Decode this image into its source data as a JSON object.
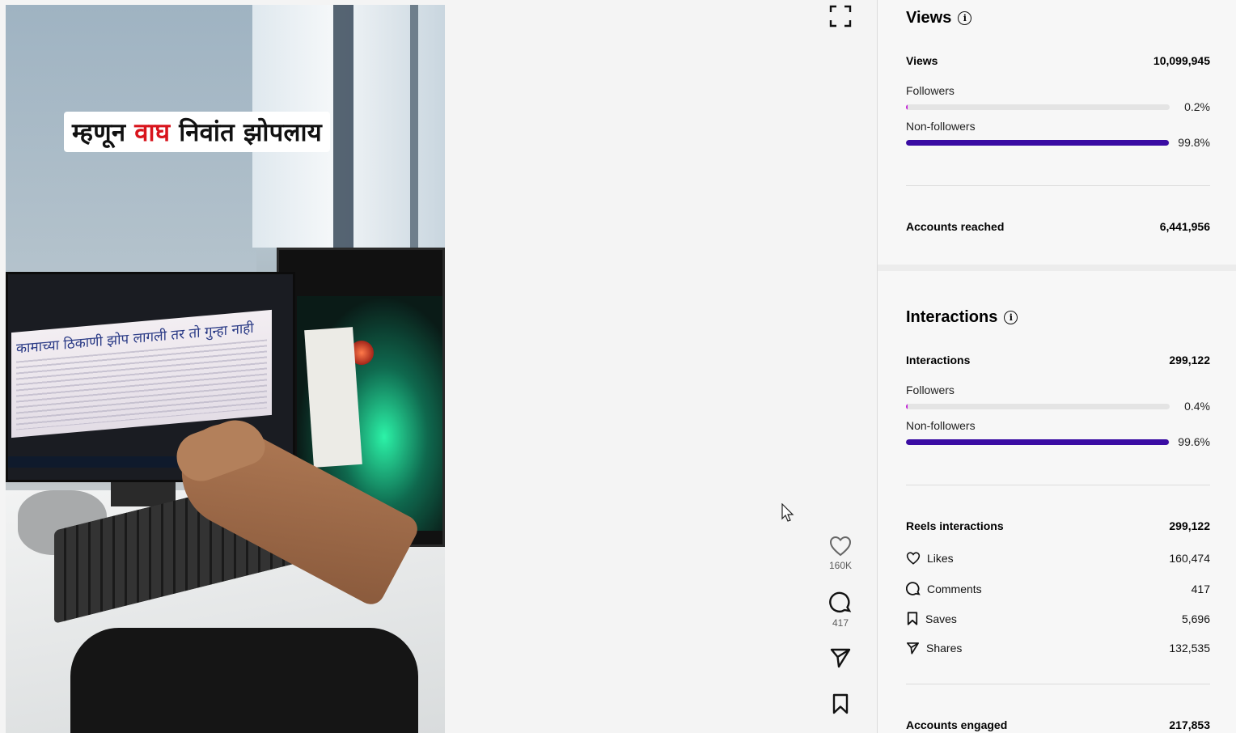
{
  "video": {
    "caption_part1": "म्हणून ",
    "caption_highlight": "वाघ",
    "caption_part2": " निवांत झोपलाय",
    "screen_headline": "कामाच्या ठिकाणी झोप लागली तर तो गुन्हा नाही"
  },
  "actions": {
    "likes_count": "160K",
    "comments_count": "417"
  },
  "views": {
    "title": "Views",
    "total_label": "Views",
    "total_value": "10,099,945",
    "followers_label": "Followers",
    "followers_pct": "0.2%",
    "followers_fraction": 0.002,
    "nonfollowers_label": "Non-followers",
    "nonfollowers_pct": "99.8%",
    "nonfollowers_fraction": 0.998,
    "reached_label": "Accounts reached",
    "reached_value": "6,441,956"
  },
  "interactions": {
    "title": "Interactions",
    "total_label": "Interactions",
    "total_value": "299,122",
    "followers_label": "Followers",
    "followers_pct": "0.4%",
    "followers_fraction": 0.004,
    "nonfollowers_label": "Non-followers",
    "nonfollowers_pct": "99.6%",
    "nonfollowers_fraction": 0.996,
    "reels_label": "Reels interactions",
    "reels_value": "299,122",
    "breakdown": [
      {
        "icon": "heart-icon",
        "label": "Likes",
        "value": "160,474"
      },
      {
        "icon": "comment-icon",
        "label": "Comments",
        "value": "417"
      },
      {
        "icon": "bookmark-icon",
        "label": "Saves",
        "value": "5,696"
      },
      {
        "icon": "share-icon",
        "label": "Shares",
        "value": "132,535"
      }
    ],
    "engaged_label": "Accounts engaged",
    "engaged_value": "217,853"
  },
  "colors": {
    "followers_bar": "#c21fd6",
    "nonfollowers_bar": "#3a0ca3",
    "track": "#e4e4e4"
  }
}
